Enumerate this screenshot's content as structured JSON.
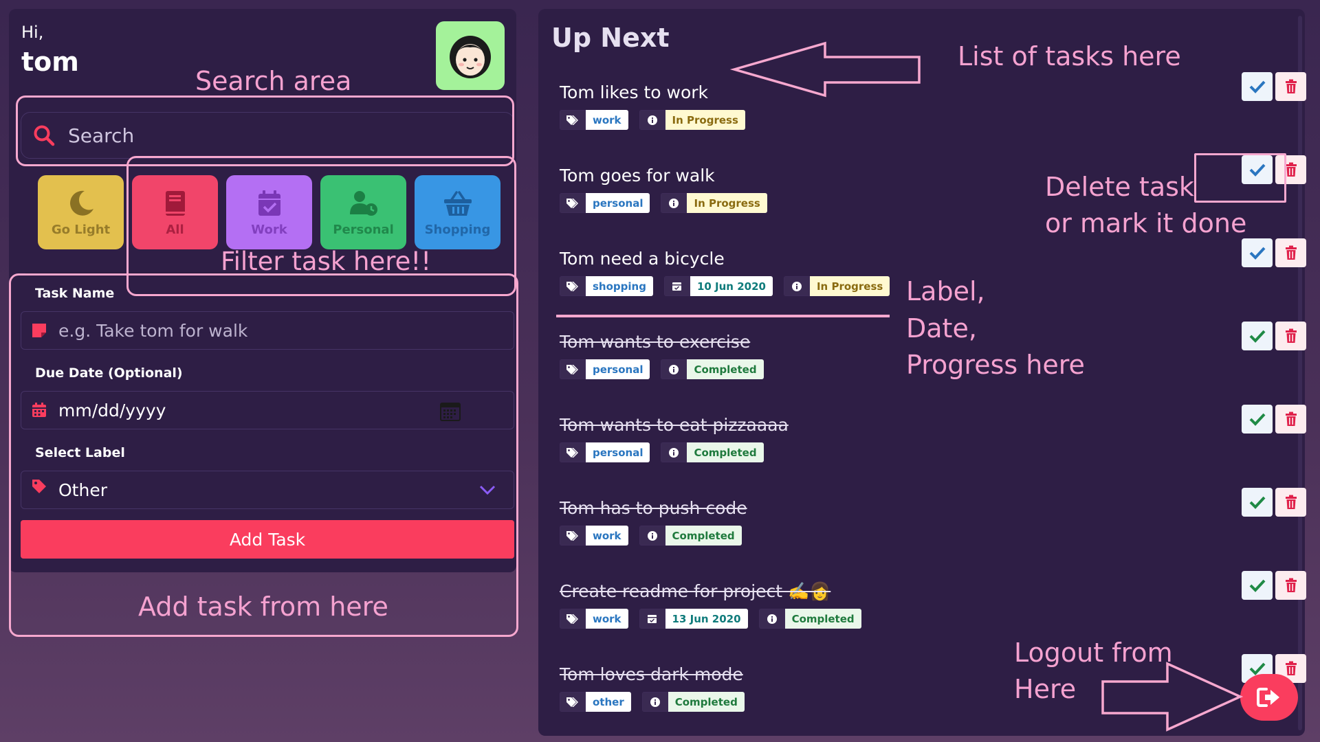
{
  "colors": {
    "accent": "#fa3d5e",
    "panel": "#2e1e45",
    "annotation": "#f7a8cf"
  },
  "header": {
    "greeting": "Hi,",
    "username": "tom",
    "avatar_icon": "avatar-girl-icon"
  },
  "search": {
    "placeholder": "Search",
    "icon": "search-icon"
  },
  "filters": [
    {
      "label": "Go Light",
      "icon": "moon-icon"
    },
    {
      "label": "All",
      "icon": "book-icon"
    },
    {
      "label": "Work",
      "icon": "calendar-check-icon"
    },
    {
      "label": "Personal",
      "icon": "user-clock-icon"
    },
    {
      "label": "Shopping",
      "icon": "basket-icon"
    }
  ],
  "form": {
    "task_name_label": "Task Name",
    "task_name_placeholder": "e.g. Take tom for walk",
    "due_date_label": "Due Date (Optional)",
    "due_date_placeholder": "mm/dd/yyyy",
    "select_label": "Select Label",
    "select_value": "Other",
    "add_button": "Add Task"
  },
  "tasks_panel": {
    "title": "Up Next",
    "tasks": [
      {
        "title": "Tom likes to work",
        "label": "work",
        "date": "",
        "status": "In Progress",
        "done": false
      },
      {
        "title": "Tom goes for walk",
        "label": "personal",
        "date": "",
        "status": "In Progress",
        "done": false
      },
      {
        "title": "Tom need a bicycle",
        "label": "shopping",
        "date": "10 Jun 2020",
        "status": "In Progress",
        "done": false
      },
      {
        "title": "Tom wants to exercise",
        "label": "personal",
        "date": "",
        "status": "Completed",
        "done": true
      },
      {
        "title": "Tom wants to eat pizzaaaa",
        "label": "personal",
        "date": "",
        "status": "Completed",
        "done": true
      },
      {
        "title": "Tom has to push code",
        "label": "work",
        "date": "",
        "status": "Completed",
        "done": true
      },
      {
        "title": "Create readme for project ✍️👩",
        "label": "work",
        "date": "13 Jun 2020",
        "status": "Completed",
        "done": true
      },
      {
        "title": "Tom loves dark mode",
        "label": "other",
        "date": "",
        "status": "Completed",
        "done": true
      }
    ]
  },
  "annotations": {
    "search_area": "Search area",
    "filter": "Filter task here!!",
    "add_task": "Add task from here",
    "list": "List of tasks here",
    "delete_line1": "Delete task",
    "delete_line2": "or mark it done",
    "label_line1": "Label,",
    "label_line2": "Date,",
    "label_line3": "Progress here",
    "logout_line1": "Logout from",
    "logout_line2": "Here"
  }
}
